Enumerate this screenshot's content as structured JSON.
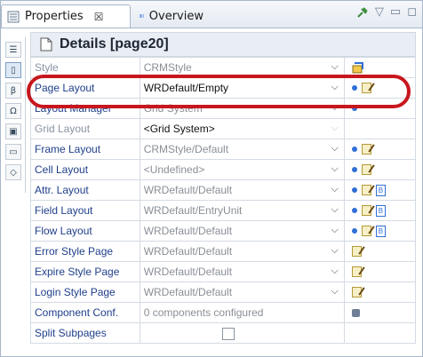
{
  "tabs": [
    {
      "label": "Properties",
      "close": "☒"
    },
    {
      "label": "Overview"
    }
  ],
  "toolbar": [
    "pin-icon",
    "menu-icon",
    "minimize-icon",
    "maximize-icon"
  ],
  "details": {
    "title": "Details [page20]"
  },
  "rows": [
    {
      "name": "Style",
      "value": "CRMStyle",
      "name_disabled": true,
      "value_disabled": true,
      "caret": true,
      "actions": [
        "style-badge"
      ]
    },
    {
      "name": "Page Layout",
      "value": "WRDefault/Empty",
      "name_disabled": false,
      "value_disabled": false,
      "caret": true,
      "actions": [
        "dot",
        "edit"
      ]
    },
    {
      "name": "Layout Manager",
      "value": "Grid System",
      "name_disabled": false,
      "value_disabled": true,
      "caret": true,
      "actions": [
        "dot"
      ]
    },
    {
      "name": "Grid Layout",
      "value": "<Grid System>",
      "name_disabled": true,
      "value_disabled": false,
      "caret": true,
      "caret_dim": true,
      "actions": []
    },
    {
      "name": "Frame Layout",
      "value": "CRMStyle/Default",
      "name_disabled": false,
      "value_disabled": true,
      "caret": true,
      "actions": [
        "dot",
        "edit"
      ]
    },
    {
      "name": "Cell Layout",
      "value": "<Undefined>",
      "name_disabled": false,
      "value_disabled": true,
      "caret": true,
      "actions": [
        "dot",
        "edit"
      ]
    },
    {
      "name": "Attr. Layout",
      "value": "WRDefault/Default",
      "name_disabled": false,
      "value_disabled": true,
      "caret": true,
      "actions": [
        "dot",
        "edit",
        "code"
      ]
    },
    {
      "name": "Field Layout",
      "value": "WRDefault/EntryUnit",
      "name_disabled": false,
      "value_disabled": true,
      "caret": true,
      "actions": [
        "dot",
        "edit",
        "code"
      ]
    },
    {
      "name": "Flow Layout",
      "value": "WRDefault/Default",
      "name_disabled": false,
      "value_disabled": true,
      "caret": true,
      "actions": [
        "dot",
        "edit",
        "code"
      ]
    },
    {
      "name": "Error Style Page",
      "value": "WRDefault/Default",
      "name_disabled": false,
      "value_disabled": true,
      "caret": true,
      "actions": [
        "edit"
      ]
    },
    {
      "name": "Expire Style Page",
      "value": "WRDefault/Default",
      "name_disabled": false,
      "value_disabled": true,
      "caret": true,
      "actions": [
        "edit"
      ]
    },
    {
      "name": "Login Style Page",
      "value": "WRDefault/Default",
      "name_disabled": false,
      "value_disabled": true,
      "caret": true,
      "actions": [
        "edit"
      ]
    },
    {
      "name": "Component Conf.",
      "value": "0 components configured",
      "name_disabled": false,
      "value_disabled": true,
      "caret": false,
      "actions": [
        "db"
      ]
    },
    {
      "name": "Split Subpages",
      "value": "",
      "name_disabled": false,
      "value_disabled": false,
      "caret": false,
      "checkbox": true,
      "actions": []
    }
  ],
  "highlight_color": "#c8161d"
}
